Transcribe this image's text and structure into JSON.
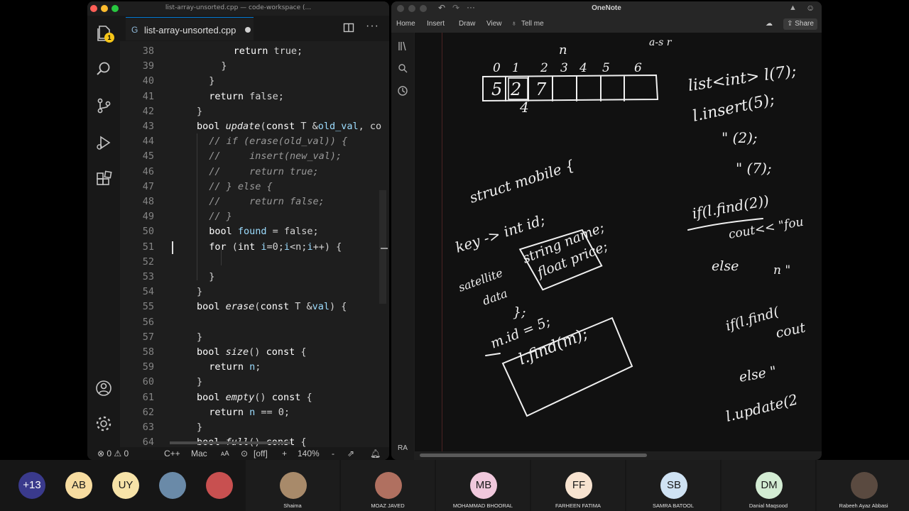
{
  "vscode": {
    "window_title": "list-array-unsorted.cpp — code-workspace (...",
    "badge_count": "1",
    "tab_label": "list-array-unsorted.cpp",
    "more_label": "···",
    "status": {
      "problems": "⊗ 0 ⚠ 0",
      "language": "C++",
      "platform": "Mac",
      "font_label": "ᴀA",
      "live_share": "[off]",
      "plus": "+",
      "zoom": "140%",
      "minus": "-"
    }
  },
  "code_lines": [
    {
      "num": "38",
      "html": "<span class=\"kw\">return</span> true;",
      "indent": 6
    },
    {
      "num": "39",
      "html": "}",
      "indent": 4
    },
    {
      "num": "40",
      "html": "}",
      "indent": 2
    },
    {
      "num": "41",
      "html": "<span class=\"kw\">return</span> false;",
      "indent": 2
    },
    {
      "num": "42",
      "html": "}",
      "indent": 0
    },
    {
      "num": "43",
      "html": "<span class=\"kw\">bool</span> <span class=\"fn\">update</span>(<span class=\"kw\">const</span> T &amp;<span class=\"var\">old_val</span>, co",
      "indent": 0
    },
    {
      "num": "44",
      "html": "<span class=\"cm\">// if (erase(old_val)) {</span>",
      "indent": 2
    },
    {
      "num": "45",
      "html": "<span class=\"cm\">//     insert(new_val);</span>",
      "indent": 2
    },
    {
      "num": "46",
      "html": "<span class=\"cm\">//     return true;</span>",
      "indent": 2
    },
    {
      "num": "47",
      "html": "<span class=\"cm\">// } else {</span>",
      "indent": 2
    },
    {
      "num": "48",
      "html": "<span class=\"cm\">//     return false;</span>",
      "indent": 2
    },
    {
      "num": "49",
      "html": "<span class=\"cm\">// }</span>",
      "indent": 2
    },
    {
      "num": "50",
      "html": "<span class=\"kw\">bool</span> <span class=\"var\">found</span> = false;",
      "indent": 2
    },
    {
      "num": "51",
      "html": "<span class=\"kw\">for</span> (<span class=\"kw\">int</span> <span class=\"var\">i</span>=0;<span class=\"var\">i</span>&lt;n;<span class=\"var\">i</span>++) {",
      "indent": 2
    },
    {
      "num": "52",
      "html": "",
      "indent": 4
    },
    {
      "num": "53",
      "html": "}",
      "indent": 2
    },
    {
      "num": "54",
      "html": "}",
      "indent": 0
    },
    {
      "num": "55",
      "html": "<span class=\"kw\">bool</span> <span class=\"fn\">erase</span>(<span class=\"kw\">const</span> T &amp;<span class=\"var\">val</span>) {",
      "indent": 0
    },
    {
      "num": "56",
      "html": "",
      "indent": 0
    },
    {
      "num": "57",
      "html": "}",
      "indent": 0
    },
    {
      "num": "58",
      "html": "<span class=\"kw\">bool</span> <span class=\"fn\">size</span>() <span class=\"kw\">const</span> {",
      "indent": 0
    },
    {
      "num": "59",
      "html": "<span class=\"kw\">return</span> <span class=\"var\">n</span>;",
      "indent": 2
    },
    {
      "num": "60",
      "html": "}",
      "indent": 0
    },
    {
      "num": "61",
      "html": "<span class=\"kw\">bool</span> <span class=\"fn\">empty</span>() <span class=\"kw\">const</span> {",
      "indent": 0
    },
    {
      "num": "62",
      "html": "<span class=\"kw\">return</span> <span class=\"var\">n</span> == 0;",
      "indent": 2
    },
    {
      "num": "63",
      "html": "}",
      "indent": 0
    },
    {
      "num": "64",
      "html": "<span class=\"kw\">bool</span> <span class=\"fn\">full</span>() <span class=\"kw\">const</span> {",
      "indent": 0
    }
  ],
  "onenote": {
    "title": "OneNote",
    "tabs": [
      "Home",
      "Insert",
      "Draw",
      "View",
      "Tell me"
    ],
    "share_label": "Share",
    "user_initials": "RA",
    "ink_text": {
      "n_label": "n",
      "indices": [
        "0",
        "1",
        "2",
        "3",
        "4",
        "5",
        "6"
      ],
      "array_vals": [
        "5",
        "2",
        "7"
      ],
      "four": "4",
      "list_decl": "list<int> l(7);",
      "insert5": "l.insert(5);",
      "insert2": "\"     (2);",
      "insert7": "\"     (7);",
      "struct": "struct mobile {",
      "key": "key -> int id;",
      "sat": "satellite",
      "data": "data",
      "str_name": "string name;",
      "flt_price": "float price;",
      "close": "};",
      "mid": "m.id = 5;",
      "lfind": "l.find(m);",
      "iflfind": "if(l.find(2))",
      "cout": "cout<< \"fou",
      "else": "else",
      "n2": "n     \"",
      "iflfind2": "if(l.find(",
      "cout2": "cout",
      "else2": "else    \"",
      "update": "l.update(2",
      "top_scribble": "a-s r"
    }
  },
  "participants": [
    {
      "initials": "+13",
      "name": "",
      "color": "#3a3a8c",
      "text_color": "#ffffff"
    },
    {
      "initials": "AB",
      "name": "",
      "color": "#f7dca0",
      "text_color": "#1a1a1a"
    },
    {
      "initials": "UY",
      "name": "",
      "color": "#f7e3a8",
      "text_color": "#1a1a1a"
    },
    {
      "initials": "",
      "name": "",
      "color": "#6a8aa8",
      "text_color": "#1a1a1a"
    },
    {
      "initials": "",
      "name": "",
      "color": "#c85050",
      "text_color": "#1a1a1a"
    },
    {
      "initials": "",
      "name": "Shaima",
      "color": "#a88a6a",
      "text_color": "#1a1a1a"
    },
    {
      "initials": "",
      "name": "MOAZ JAVED",
      "color": "#b07060",
      "text_color": "#1a1a1a"
    },
    {
      "initials": "MB",
      "name": "MOHAMMAD BHOORAL",
      "color": "#f0c8dc",
      "text_color": "#1a1a1a"
    },
    {
      "initials": "FF",
      "name": "FARHEEN FATIMA",
      "color": "#f7e3d0",
      "text_color": "#1a1a1a"
    },
    {
      "initials": "SB",
      "name": "SAMRA BATOOL",
      "color": "#cfe2f3",
      "text_color": "#1a1a1a"
    },
    {
      "initials": "DM",
      "name": "Danial Maqsood",
      "color": "#d3ecd3",
      "text_color": "#1a1a1a"
    },
    {
      "initials": "",
      "name": "Rabeeh Ayaz Abbasi",
      "color": "#5a4a40",
      "text_color": "#1a1a1a"
    }
  ]
}
